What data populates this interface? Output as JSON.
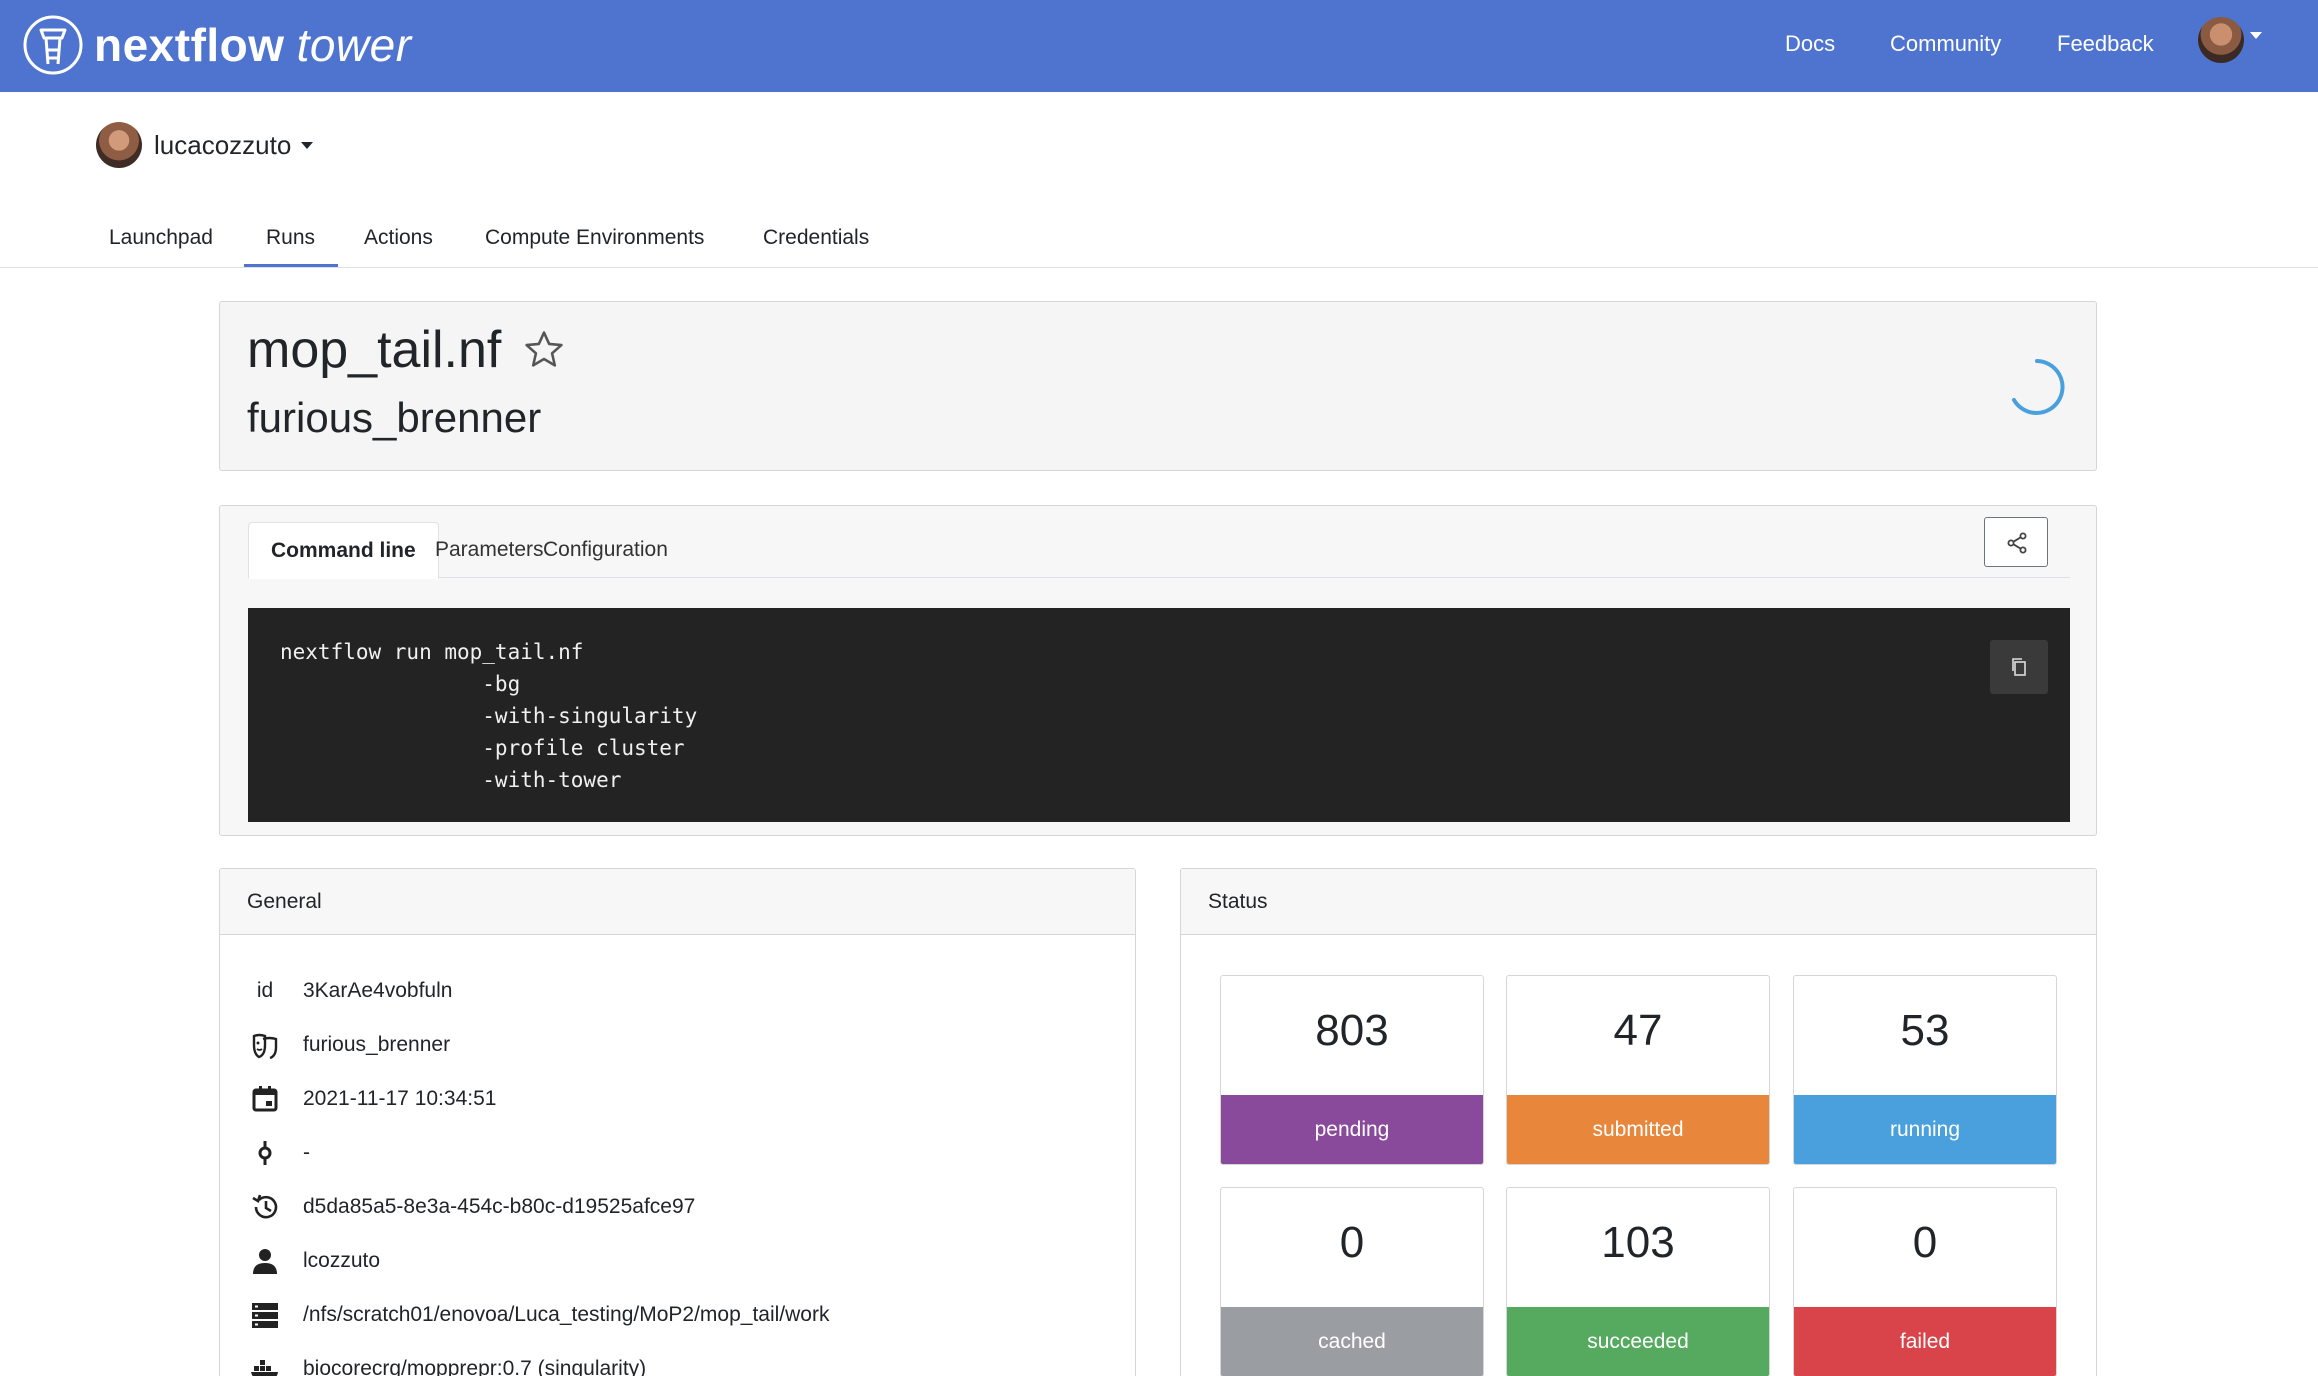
{
  "navbar": {
    "brand_name": "nextflow",
    "brand_suffix": "tower",
    "links": [
      "Docs",
      "Community",
      "Feedback"
    ],
    "color": "#4e74cf"
  },
  "workspace": {
    "name": "lucacozzuto"
  },
  "tabs": [
    "Launchpad",
    "Runs",
    "Actions",
    "Compute Environments",
    "Credentials"
  ],
  "active_tab": "Runs",
  "run": {
    "title": "mop_tail.nf",
    "name": "furious_brenner"
  },
  "detail_tabs": [
    "Command line",
    "Parameters",
    "Configuration"
  ],
  "active_detail_tab": "Command line",
  "command_lines": [
    "nextflow run mop_tail.nf",
    "                -bg",
    "                -with-singularity",
    "                -profile cluster",
    "                -with-tower"
  ],
  "general": {
    "title": "General",
    "rows": [
      {
        "icon": "id-label",
        "value": "3KarAe4vobfuln"
      },
      {
        "icon": "masks-icon",
        "value": "furious_brenner"
      },
      {
        "icon": "calendar-icon",
        "value": "2021-11-17 10:34:51"
      },
      {
        "icon": "commit-icon",
        "value": "-"
      },
      {
        "icon": "history-icon",
        "value": "d5da85a5-8e3a-454c-b80c-d19525afce97"
      },
      {
        "icon": "user-icon",
        "value": "lcozzuto"
      },
      {
        "icon": "server-icon",
        "value": "/nfs/scratch01/enovoa/Luca_testing/MoP2/mop_tail/work"
      },
      {
        "icon": "docker-icon",
        "value": "biocorecrg/mopprepr:0.7 (singularity)"
      }
    ],
    "id_label": "id"
  },
  "status": {
    "title": "Status",
    "cards": [
      {
        "value": "803",
        "label": "pending",
        "color": "#8a4a9c"
      },
      {
        "value": "47",
        "label": "submitted",
        "color": "#e8873b"
      },
      {
        "value": "53",
        "label": "running",
        "color": "#4aa0dc"
      },
      {
        "value": "0",
        "label": "cached",
        "color": "#9a9ea3"
      },
      {
        "value": "103",
        "label": "succeeded",
        "color": "#55aa5f"
      },
      {
        "value": "0",
        "label": "failed",
        "color": "#d9434a"
      }
    ]
  }
}
